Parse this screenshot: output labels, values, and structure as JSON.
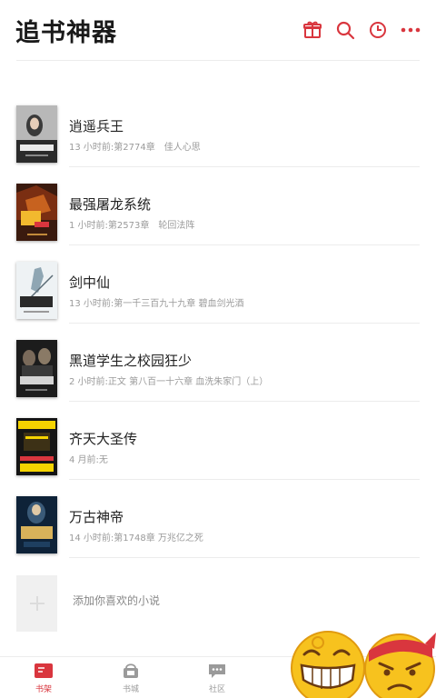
{
  "app": {
    "title": "追书神器",
    "accent_color": "#d9363e"
  },
  "header": {
    "icons": [
      "gift-icon",
      "search-icon",
      "history-icon",
      "more-icon"
    ]
  },
  "books": [
    {
      "title": "逍遥兵王",
      "meta": "13 小时前:第2774章　佳人心思",
      "cover_colors": [
        "#2b2b2b",
        "#a9a9a9"
      ]
    },
    {
      "title": "最强屠龙系统",
      "meta": "1 小时前:第2573章　轮回法阵",
      "cover_colors": [
        "#3a1a0e",
        "#c7621f"
      ]
    },
    {
      "title": "剑中仙",
      "meta": "13 小时前:第一千三百九十九章 碧血剑光酒",
      "cover_colors": [
        "#eef2f4",
        "#555555"
      ]
    },
    {
      "title": "黑道学生之校园狂少",
      "meta": "2 小时前:正文 第八百一十六章 血洗朱家门（上）",
      "cover_colors": [
        "#1c1c1c",
        "#8a8a8a"
      ]
    },
    {
      "title": "齐天大圣传",
      "meta": "4 月前:无",
      "cover_colors": [
        "#151515",
        "#f5d300"
      ]
    },
    {
      "title": "万古神帝",
      "meta": "14 小时前:第1748章 万兆亿之死",
      "cover_colors": [
        "#0e2238",
        "#d8b25a"
      ]
    }
  ],
  "add_book": {
    "label": "添加你喜欢的小说"
  },
  "tabs": [
    {
      "label": "书架",
      "icon": "bookshelf-icon",
      "active": true
    },
    {
      "label": "书城",
      "icon": "bookstore-icon",
      "active": false
    },
    {
      "label": "社区",
      "icon": "community-icon",
      "active": false
    }
  ],
  "colors": {
    "active_tab": "#d9363e",
    "inactive_tab": "#9a9a9a",
    "divider": "#ececec"
  }
}
